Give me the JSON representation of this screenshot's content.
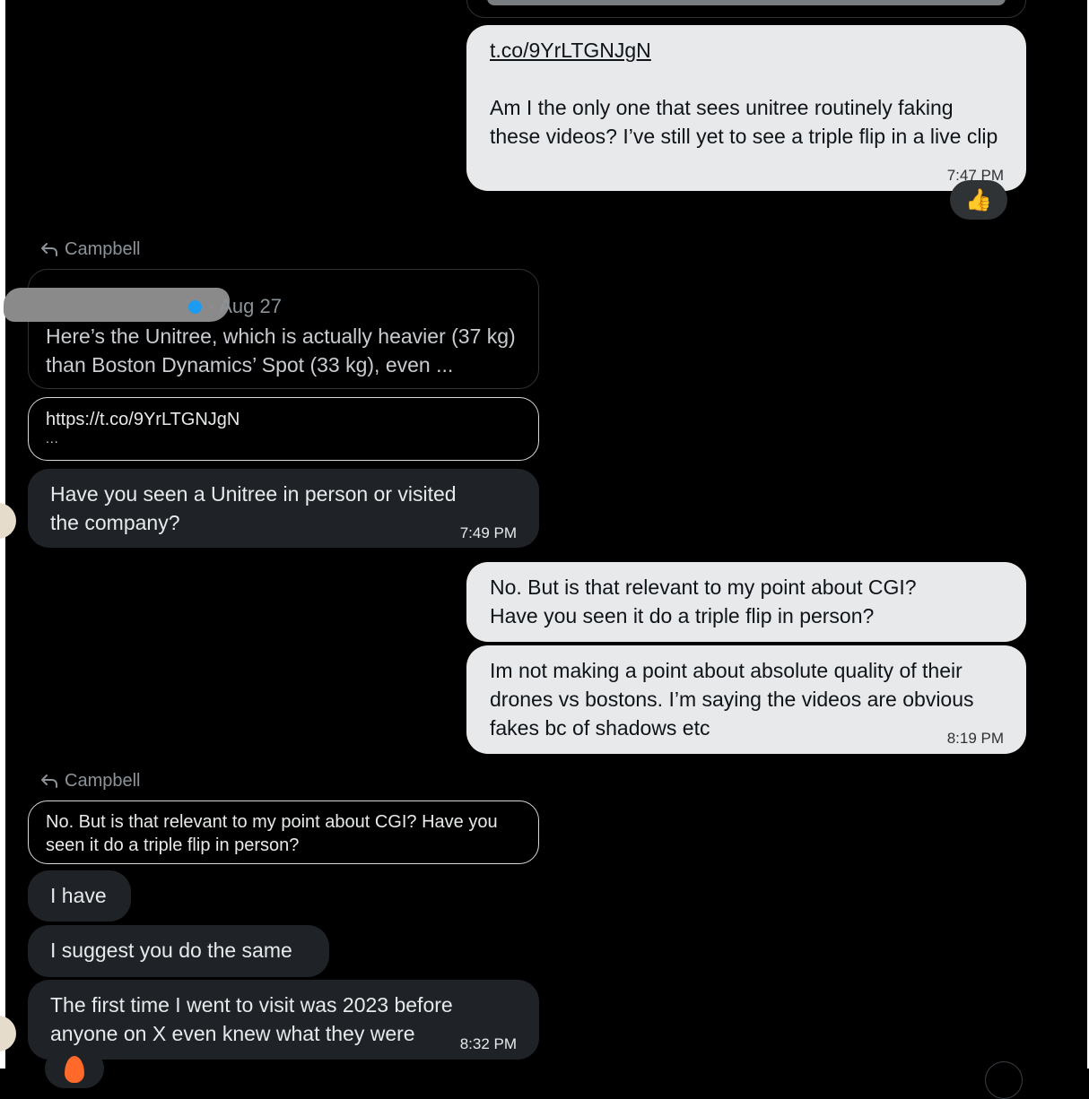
{
  "messages": {
    "m1": {
      "link": "t.co/9YrLTGNJgN",
      "text": "Am I the only one that sees unitree routinely faking these videos?  I’ve still yet to see a triple flip in a live clip",
      "time": "7:47 PM",
      "reaction": "👍"
    },
    "reply1": {
      "label": "Campbell",
      "quote_date": "· Aug 27",
      "quote_text": "Here’s the Unitree, which is actually heavier (37 kg) than Boston Dynamics’ Spot (33 kg), even ...",
      "link_url": "https://t.co/9YrLTGNJgN",
      "link_more": "..."
    },
    "m2": {
      "text": "Have you seen a Unitree in person or visited the company?",
      "time": "7:49 PM"
    },
    "m3": {
      "text": "No.  But is that relevant to my point about CGI?  Have you seen it do a triple flip in person?"
    },
    "m4": {
      "text": "Im not making a point about absolute quality of their drones vs bostons. I’m saying the videos are obvious  fakes bc of shadows etc",
      "time": "8:19 PM"
    },
    "reply2": {
      "label": "Campbell",
      "quote_text": "No.  But is that relevant to my point about CGI?  Have you seen it do a triple flip in person?"
    },
    "m5": {
      "text": "I have"
    },
    "m6": {
      "text": "I suggest you do the same"
    },
    "m7": {
      "text": "The first time I went to visit was 2023 before anyone on X even knew what they were",
      "time": "8:32 PM"
    }
  },
  "colors": {
    "background": "#000000",
    "outgoing_bubble": "#e8e9eb",
    "incoming_bubble": "#1f2327",
    "muted_text": "#8b9399",
    "verified": "#1d9bf0"
  },
  "icons": {
    "reply": "reply-arrow-icon",
    "verified": "verified-badge-icon",
    "reaction_thumbs": "thumbs-up-emoji",
    "reaction_fire": "fire-emoji"
  }
}
